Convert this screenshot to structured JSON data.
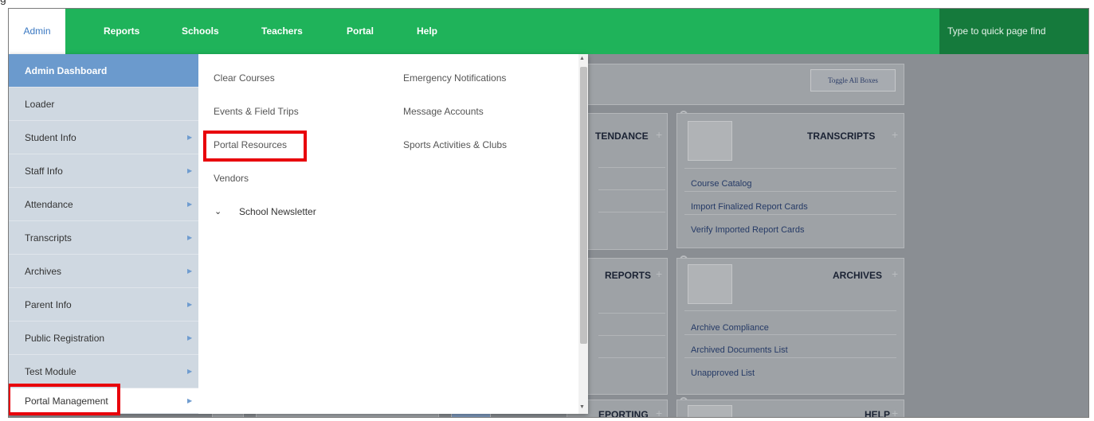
{
  "nav": {
    "tabs": [
      "Admin",
      "Reports",
      "Schools",
      "Teachers",
      "Portal",
      "Help"
    ],
    "quick_find_placeholder": "Type to quick page find"
  },
  "menu": {
    "left": [
      {
        "label": "Admin Dashboard"
      },
      {
        "label": "Loader"
      },
      {
        "label": "Student Info"
      },
      {
        "label": "Staff Info"
      },
      {
        "label": "Attendance"
      },
      {
        "label": "Transcripts"
      },
      {
        "label": "Archives"
      },
      {
        "label": "Parent Info"
      },
      {
        "label": "Public Registration"
      },
      {
        "label": "Test Module"
      },
      {
        "label": "Portal Management"
      }
    ],
    "col2": [
      "Clear Courses",
      "Events & Field Trips",
      "Portal Resources",
      "Vendors",
      "School Newsletter"
    ],
    "col3": [
      "Emergency Notifications",
      "Message Accounts",
      "Sports Activities & Clubs"
    ]
  },
  "background": {
    "toggle_label": "Toggle All Boxes",
    "panes": {
      "attendance": "TENDANCE",
      "transcripts": "TRANSCRIPTS",
      "reports": "REPORTS",
      "archives": "ARCHIVES",
      "reporting": "EPORTING",
      "help": "HELP"
    },
    "transcripts_links": [
      "Course Catalog",
      "Import Finalized Report Cards",
      "Verify Imported Report Cards"
    ],
    "archives_links": [
      "Archive Compliance",
      "Archived Documents List",
      "Unapproved List"
    ]
  },
  "colors": {
    "nav_green": "#1fb35a",
    "quick_find_bg": "#157a3c",
    "highlight_red": "#e8000b",
    "menu_head_blue": "#6b9acd"
  },
  "icons": {
    "submenu_arrow": "triangle-right-icon",
    "expand": "chevron-down-icon",
    "plus": "plus-icon"
  }
}
